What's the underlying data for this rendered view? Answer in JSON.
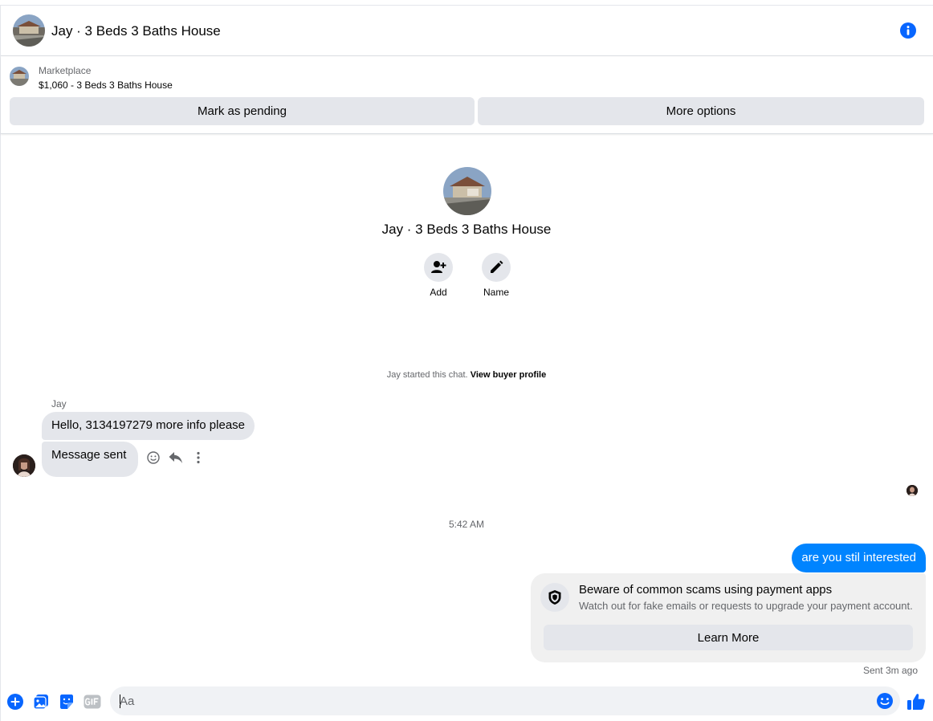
{
  "header": {
    "title": "Jay · 3 Beds 3 Baths House",
    "icons": {
      "info": "info-icon"
    }
  },
  "marketplace": {
    "kicker": "Marketplace",
    "listing": "$1,060 - 3 Beds 3 Baths House",
    "mark_pending_label": "Mark as pending",
    "more_options_label": "More options"
  },
  "profile": {
    "name": "Jay · 3 Beds 3 Baths House",
    "actions": [
      {
        "label": "Add",
        "icon": "add-person-icon"
      },
      {
        "label": "Name",
        "icon": "pencil-icon"
      }
    ]
  },
  "conversation": {
    "started_text": "Jay started this chat.",
    "view_profile_link": "View buyer profile",
    "incoming": {
      "sender": "Jay",
      "messages": [
        "Hello, 3134197279 more info please",
        "Message sent"
      ]
    },
    "timestamp": "5:42 AM",
    "outgoing": {
      "message": "are you stil interested",
      "status": "Sent 3m ago"
    },
    "scam_notice": {
      "title": "Beware of common scams using payment apps",
      "body": "Watch out for fake emails or requests to upgrade your payment account.",
      "button": "Learn More"
    }
  },
  "composer": {
    "placeholder": "Aa",
    "icons": [
      "plus-icon",
      "photo-icon",
      "sticker-icon",
      "gif-icon",
      "emoji-icon",
      "thumbs-up-icon"
    ]
  },
  "colors": {
    "accent": "#0084ff",
    "icon_blue": "#0866ff",
    "bubble_gray": "#e4e6eb",
    "secondary_text": "#65676b"
  }
}
